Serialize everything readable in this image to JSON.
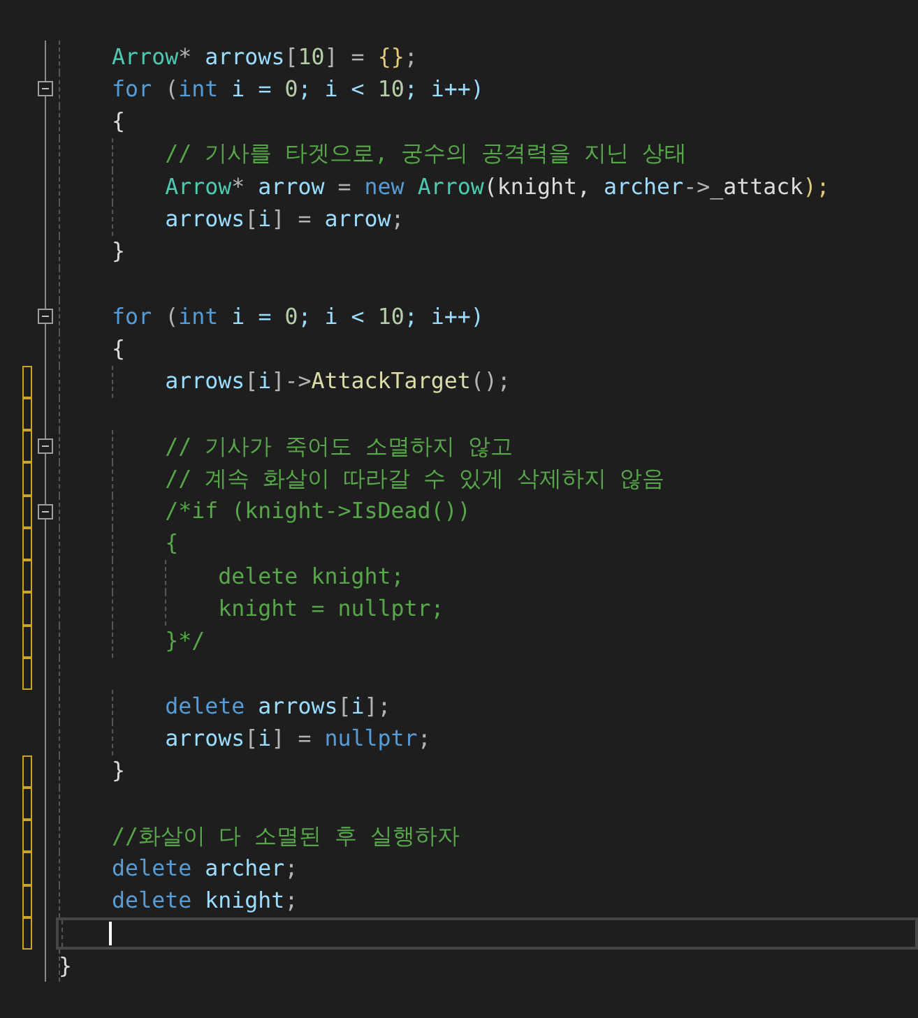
{
  "editor": {
    "lines": [
      {
        "fold_marker": false,
        "changed": false,
        "current": false,
        "tokens": [
          {
            "text": "    Arrow",
            "kind": "type"
          },
          {
            "text": "* ",
            "kind": "op"
          },
          {
            "text": "arrows",
            "kind": "var"
          },
          {
            "text": "[",
            "kind": "op"
          },
          {
            "text": "10",
            "kind": "num"
          },
          {
            "text": "] = ",
            "kind": "op"
          },
          {
            "text": "{}",
            "kind": "brace"
          },
          {
            "text": ";",
            "kind": "op"
          }
        ]
      },
      {
        "fold_marker": true,
        "changed": false,
        "current": false,
        "tokens": [
          {
            "text": "    for",
            "kind": "kw"
          },
          {
            "text": " (",
            "kind": "op"
          },
          {
            "text": "int",
            "kind": "kw"
          },
          {
            "text": " i = ",
            "kind": "var"
          },
          {
            "text": "0",
            "kind": "num"
          },
          {
            "text": "; i < ",
            "kind": "var"
          },
          {
            "text": "10",
            "kind": "num"
          },
          {
            "text": "; i++)",
            "kind": "var"
          }
        ]
      },
      {
        "fold_marker": false,
        "changed": false,
        "current": false,
        "tokens": [
          {
            "text": "    {",
            "kind": "punct"
          }
        ]
      },
      {
        "fold_marker": false,
        "changed": false,
        "current": false,
        "tokens": [
          {
            "text": "        // 기사를 타겟으로, 궁수의 공격력을 지닌 상태",
            "kind": "comment"
          }
        ]
      },
      {
        "fold_marker": false,
        "changed": false,
        "current": false,
        "tokens": [
          {
            "text": "        Arrow",
            "kind": "type"
          },
          {
            "text": "* ",
            "kind": "op"
          },
          {
            "text": "arrow",
            "kind": "var"
          },
          {
            "text": " = ",
            "kind": "op"
          },
          {
            "text": "new",
            "kind": "kw"
          },
          {
            "text": " Arrow",
            "kind": "type"
          },
          {
            "text": "(knight, ",
            "kind": "punct"
          },
          {
            "text": "archer",
            "kind": "var"
          },
          {
            "text": "->",
            "kind": "op"
          },
          {
            "text": "_attack",
            "kind": "punct"
          },
          {
            "text": ");",
            "kind": "brace"
          }
        ]
      },
      {
        "fold_marker": false,
        "changed": false,
        "current": false,
        "tokens": [
          {
            "text": "        arrows",
            "kind": "var"
          },
          {
            "text": "[",
            "kind": "op"
          },
          {
            "text": "i",
            "kind": "var"
          },
          {
            "text": "] = ",
            "kind": "op"
          },
          {
            "text": "arrow",
            "kind": "var"
          },
          {
            "text": ";",
            "kind": "op"
          }
        ]
      },
      {
        "fold_marker": false,
        "changed": false,
        "current": false,
        "tokens": [
          {
            "text": "    }",
            "kind": "punct"
          }
        ]
      },
      {
        "fold_marker": false,
        "changed": false,
        "current": false
      },
      {
        "fold_marker": true,
        "changed": false,
        "current": false,
        "tokens": [
          {
            "text": "    for",
            "kind": "kw"
          },
          {
            "text": " (",
            "kind": "op"
          },
          {
            "text": "int",
            "kind": "kw"
          },
          {
            "text": " i = ",
            "kind": "var"
          },
          {
            "text": "0",
            "kind": "num"
          },
          {
            "text": "; i < ",
            "kind": "var"
          },
          {
            "text": "10",
            "kind": "num"
          },
          {
            "text": "; i++)",
            "kind": "var"
          }
        ]
      },
      {
        "fold_marker": false,
        "changed": false,
        "current": false,
        "tokens": [
          {
            "text": "    {",
            "kind": "punct"
          }
        ]
      },
      {
        "fold_marker": false,
        "changed": true,
        "current": false,
        "tokens": [
          {
            "text": "        arrows",
            "kind": "var"
          },
          {
            "text": "[",
            "kind": "op"
          },
          {
            "text": "i",
            "kind": "var"
          },
          {
            "text": "]->",
            "kind": "op"
          },
          {
            "text": "AttackTarget",
            "kind": "fn"
          },
          {
            "text": "();",
            "kind": "op"
          }
        ]
      },
      {
        "fold_marker": false,
        "changed": true,
        "current": false
      },
      {
        "fold_marker": true,
        "changed": true,
        "current": false,
        "tokens": [
          {
            "text": "        // 기사가 죽어도 소멸하지 않고",
            "kind": "comment"
          }
        ]
      },
      {
        "fold_marker": false,
        "changed": true,
        "current": false,
        "tokens": [
          {
            "text": "        // 계속 화살이 따라갈 수 있게 삭제하지 않음",
            "kind": "comment"
          }
        ]
      },
      {
        "fold_marker": true,
        "changed": true,
        "current": false,
        "tokens": [
          {
            "text": "        /*if (knight->IsDead())",
            "kind": "comment"
          }
        ]
      },
      {
        "fold_marker": false,
        "changed": true,
        "current": false,
        "tokens": [
          {
            "text": "        {",
            "kind": "comment"
          }
        ]
      },
      {
        "fold_marker": false,
        "changed": true,
        "current": false,
        "tokens": [
          {
            "text": "            delete knight;",
            "kind": "comment"
          }
        ]
      },
      {
        "fold_marker": false,
        "changed": true,
        "current": false,
        "tokens": [
          {
            "text": "            knight = nullptr;",
            "kind": "comment"
          }
        ]
      },
      {
        "fold_marker": false,
        "changed": true,
        "current": false,
        "tokens": [
          {
            "text": "        }*/",
            "kind": "comment"
          }
        ]
      },
      {
        "fold_marker": false,
        "changed": true,
        "current": false
      },
      {
        "fold_marker": false,
        "changed": false,
        "current": false,
        "tokens": [
          {
            "text": "        delete",
            "kind": "kw"
          },
          {
            "text": " arrows",
            "kind": "var"
          },
          {
            "text": "[",
            "kind": "op"
          },
          {
            "text": "i",
            "kind": "var"
          },
          {
            "text": "];",
            "kind": "op"
          }
        ]
      },
      {
        "fold_marker": false,
        "changed": false,
        "current": false,
        "tokens": [
          {
            "text": "        arrows",
            "kind": "var"
          },
          {
            "text": "[",
            "kind": "op"
          },
          {
            "text": "i",
            "kind": "var"
          },
          {
            "text": "] = ",
            "kind": "op"
          },
          {
            "text": "nullptr",
            "kind": "kw"
          },
          {
            "text": ";",
            "kind": "op"
          }
        ]
      },
      {
        "fold_marker": false,
        "changed": true,
        "current": false,
        "tokens": [
          {
            "text": "    }",
            "kind": "punct"
          }
        ]
      },
      {
        "fold_marker": false,
        "changed": true,
        "current": false
      },
      {
        "fold_marker": false,
        "changed": true,
        "current": false,
        "tokens": [
          {
            "text": "    //화살이 다 소멸된 후 실행하자",
            "kind": "comment"
          }
        ]
      },
      {
        "fold_marker": false,
        "changed": true,
        "current": false,
        "tokens": [
          {
            "text": "    delete",
            "kind": "kw"
          },
          {
            "text": " archer",
            "kind": "var"
          },
          {
            "text": ";",
            "kind": "op"
          }
        ]
      },
      {
        "fold_marker": false,
        "changed": true,
        "current": false,
        "tokens": [
          {
            "text": "    delete",
            "kind": "kw"
          },
          {
            "text": " knight",
            "kind": "var"
          },
          {
            "text": ";",
            "kind": "op"
          }
        ]
      },
      {
        "fold_marker": false,
        "changed": true,
        "current": true
      },
      {
        "fold_marker": false,
        "changed": false,
        "current": false,
        "tokens": [
          {
            "text": "}",
            "kind": "punct"
          }
        ]
      }
    ]
  }
}
